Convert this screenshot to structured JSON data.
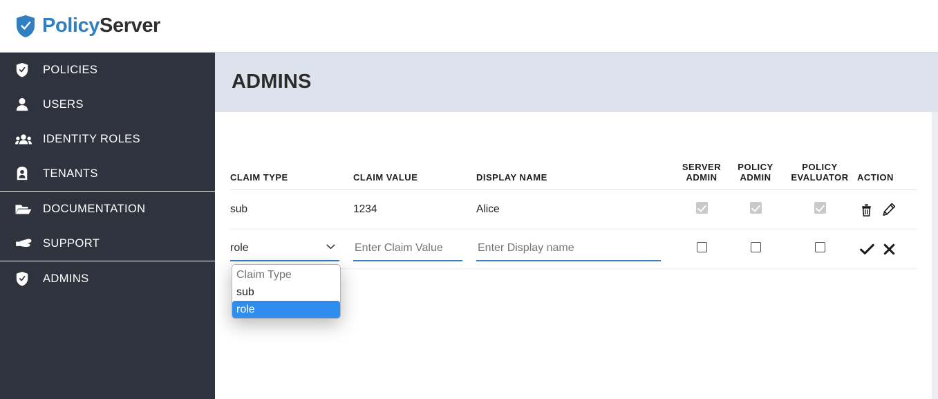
{
  "brand": {
    "name_first": "Policy",
    "name_second": "Server",
    "logo_icon": "shield-check-icon",
    "color_primary": "#2f7fc1",
    "color_secondary": "#2f2f2f"
  },
  "sidebar": {
    "background": "#2f333d",
    "groups": [
      {
        "items": [
          {
            "label": "POLICIES",
            "icon": "shield-check-icon"
          },
          {
            "label": "USERS",
            "icon": "user-icon"
          },
          {
            "label": "IDENTITY ROLES",
            "icon": "users-group-icon"
          },
          {
            "label": "TENANTS",
            "icon": "tenant-badge-icon"
          }
        ]
      },
      {
        "items": [
          {
            "label": "DOCUMENTATION",
            "icon": "folder-open-icon"
          },
          {
            "label": "SUPPORT",
            "icon": "pointing-hand-icon"
          }
        ]
      },
      {
        "items": [
          {
            "label": "ADMINS",
            "icon": "shield-check-icon"
          }
        ]
      }
    ]
  },
  "page": {
    "title": "ADMINS",
    "banner_color": "#dde3ec"
  },
  "table": {
    "headers": {
      "claim_type": "CLAIM TYPE",
      "claim_value": "CLAIM VALUE",
      "display_name": "DISPLAY NAME",
      "server_admin_l1": "SERVER",
      "server_admin_l2": "ADMIN",
      "policy_admin_l1": "POLICY",
      "policy_admin_l2": "ADMIN",
      "policy_evaluator_l1": "POLICY",
      "policy_evaluator_l2": "EVALUATOR",
      "action": "ACTION"
    },
    "rows": [
      {
        "claim_type": "sub",
        "claim_value": "1234",
        "display_name": "Alice",
        "server_admin": true,
        "policy_admin": true,
        "policy_evaluator": true,
        "checkboxes_disabled": true,
        "actions": [
          "delete-icon",
          "edit-icon"
        ]
      }
    ],
    "edit_row": {
      "claim_type_value": "role",
      "claim_value_placeholder": "Enter Claim Value",
      "claim_value_text": "",
      "display_name_placeholder": "Enter Display name",
      "display_name_text": "",
      "server_admin": false,
      "policy_admin": false,
      "policy_evaluator": false,
      "actions": [
        "confirm-check-icon",
        "cancel-x-icon"
      ]
    }
  },
  "dropdown": {
    "open": true,
    "options": [
      {
        "label": "Claim Type",
        "placeholder": true,
        "selected": false
      },
      {
        "label": "sub",
        "placeholder": false,
        "selected": false
      },
      {
        "label": "role",
        "placeholder": false,
        "selected": true
      }
    ],
    "highlight_color": "#2f8eed"
  }
}
